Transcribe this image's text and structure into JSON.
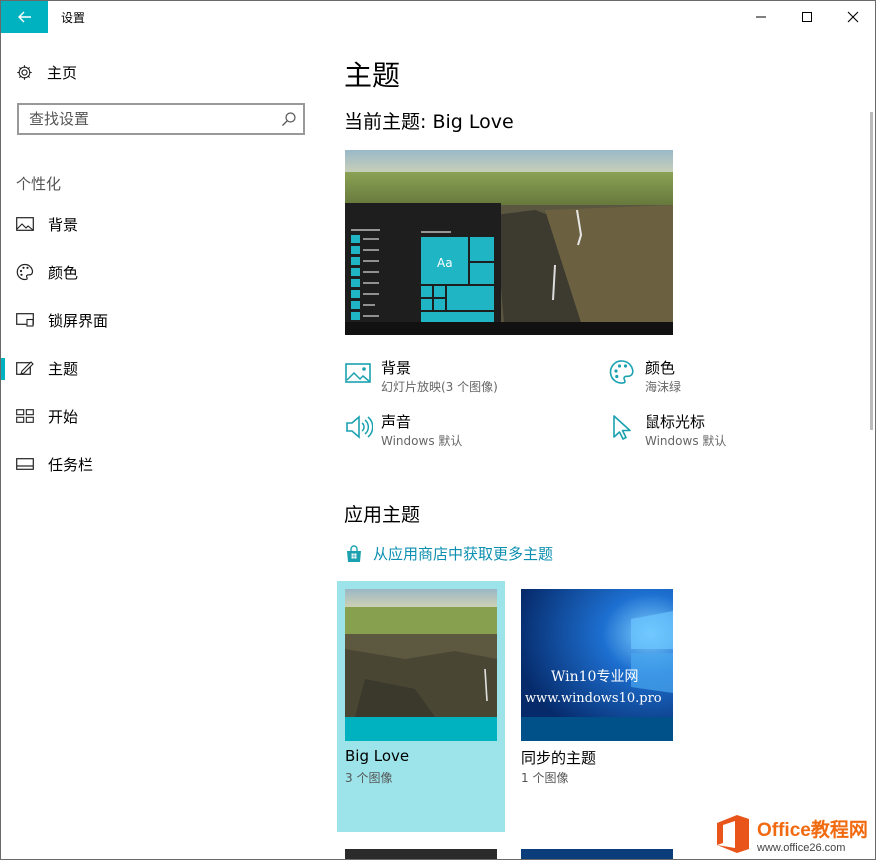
{
  "window": {
    "title": "设置",
    "controls": [
      "minimize-icon",
      "maximize-icon",
      "close-icon"
    ]
  },
  "sidebar": {
    "home_label": "主页",
    "search_placeholder": "查找设置",
    "section_label": "个性化",
    "items": [
      {
        "label": "背景",
        "icon": "picture-icon"
      },
      {
        "label": "颜色",
        "icon": "palette-icon"
      },
      {
        "label": "锁屏界面",
        "icon": "lockscreen-icon"
      },
      {
        "label": "主题",
        "icon": "theme-brush-icon",
        "selected": true
      },
      {
        "label": "开始",
        "icon": "start-icon"
      },
      {
        "label": "任务栏",
        "icon": "taskbar-icon"
      }
    ]
  },
  "main": {
    "title": "主题",
    "current_theme": "当前主题: Big Love",
    "preview_tile_text": "Aa",
    "properties": [
      {
        "name": "背景",
        "value": "幻灯片放映(3 个图像)",
        "icon": "picture-icon"
      },
      {
        "name": "颜色",
        "value": "海沫绿",
        "icon": "palette-icon"
      },
      {
        "name": "声音",
        "value": "Windows 默认",
        "icon": "speaker-icon"
      },
      {
        "name": "鼠标光标",
        "value": "Windows 默认",
        "icon": "cursor-icon"
      }
    ],
    "apply_title": "应用主题",
    "store_link": "从应用商店中获取更多主题",
    "themes": [
      {
        "name": "Big Love",
        "count": "3 个图像",
        "selected": true
      },
      {
        "name": "同步的主题",
        "count": "1 个图像",
        "overlay_line1": "Win10专业网",
        "overlay_line2": "www.windows10.pro"
      }
    ]
  },
  "watermark": {
    "brand": "Office教程网",
    "url": "www.office26.com"
  },
  "colors": {
    "accent": "#00b2bf",
    "link": "#0d8fb0",
    "selected_tile": "#9de4ea"
  }
}
